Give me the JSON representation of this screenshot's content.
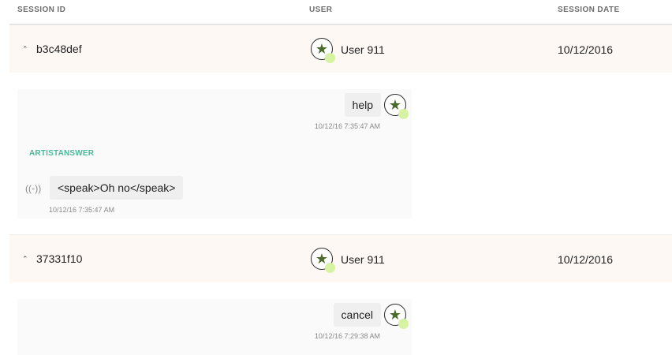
{
  "header": {
    "session_id": "SESSION ID",
    "user": "USER",
    "session_date": "SESSION DATE"
  },
  "sessions": [
    {
      "id": "b3c48def",
      "user": "User 911",
      "date": "10/12/2016",
      "expanded": true,
      "messages": [
        {
          "from": "user",
          "text": "help",
          "time": "10/12/16 7:35:47 AM"
        },
        {
          "from": "bot",
          "label": "ARTISTANSWER",
          "text": "<speak>Oh no</speak>",
          "time": "10/12/16 7:35:47 AM"
        }
      ]
    },
    {
      "id": "37331f10",
      "user": "User 911",
      "date": "10/12/2016",
      "expanded": true,
      "messages": [
        {
          "from": "user",
          "text": "cancel",
          "time": "10/12/16 7:29:38 AM"
        }
      ]
    }
  ],
  "icons": {
    "expand": "chevron-up-icon",
    "avatar": "star-avatar-icon",
    "bot": "broadcast-icon"
  },
  "colors": {
    "session_row_bg": "#fdf8f4",
    "panel_bg": "#fafafa",
    "bubble_bg": "#efefef",
    "label_green": "#4cb89a",
    "avatar_star": "#4a6b2c",
    "avatar_dot": "#d6f2a3"
  }
}
